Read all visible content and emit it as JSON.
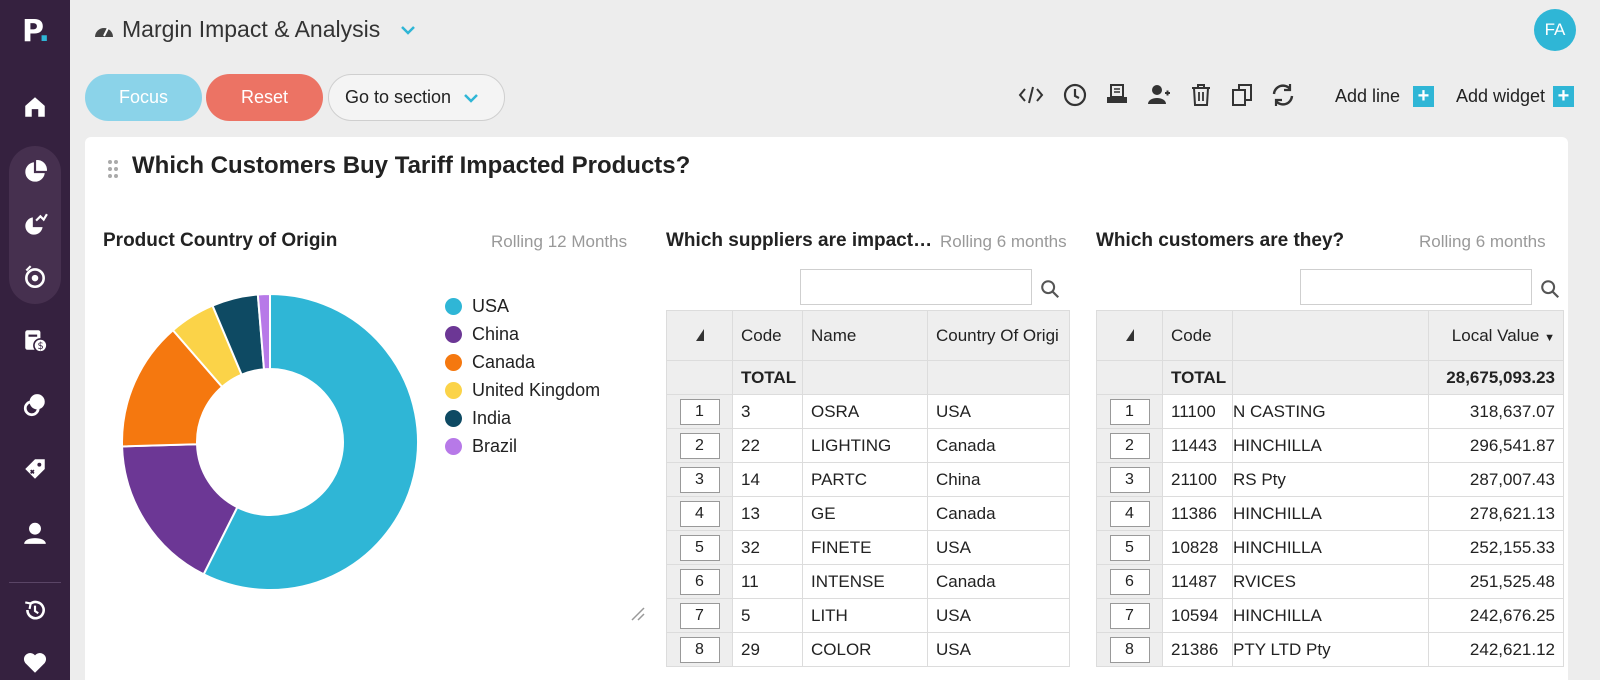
{
  "app": {
    "logo_letter": "P",
    "logo_dot": ".",
    "page_title": "Margin Impact & Analysis",
    "avatar_initials": "FA"
  },
  "toolbar": {
    "focus_label": "Focus",
    "reset_label": "Reset",
    "goto_label": "Go to section",
    "add_line_label": "Add line",
    "add_widget_label": "Add widget"
  },
  "section": {
    "title": "Which Customers Buy Tariff Impacted Products?"
  },
  "widgets": {
    "origin": {
      "title": "Product Country of Origin",
      "period": "Rolling 12 Months"
    },
    "suppliers": {
      "title": "Which suppliers are impact…",
      "period": "Rolling 6 months"
    },
    "customers": {
      "title": "Which customers are they?",
      "period": "Rolling 6 months"
    }
  },
  "chart_data": {
    "type": "pie",
    "categories": [
      "USA",
      "China",
      "Canada",
      "United Kingdom",
      "India",
      "Brazil"
    ],
    "values": [
      57,
      17,
      14,
      5,
      5,
      1.3
    ],
    "colors": [
      "#2fb6d6",
      "#6c3795",
      "#f5780f",
      "#fbd348",
      "#0e4a63",
      "#b779e8"
    ],
    "legend": "right"
  },
  "suppliers_table": {
    "headers": [
      "Code",
      "Name",
      "Country Of Origi"
    ],
    "total_label": "TOTAL",
    "rows": [
      {
        "n": "1",
        "code": "3",
        "name": "OSRA",
        "country": "USA"
      },
      {
        "n": "2",
        "code": "22",
        "name": "LIGHTING",
        "country": "Canada"
      },
      {
        "n": "3",
        "code": "14",
        "name": "PARTC",
        "country": "China"
      },
      {
        "n": "4",
        "code": "13",
        "name": "GE",
        "country": "Canada"
      },
      {
        "n": "5",
        "code": "32",
        "name": "FINETE",
        "country": "USA"
      },
      {
        "n": "6",
        "code": "11",
        "name": "INTENSE",
        "country": "Canada"
      },
      {
        "n": "7",
        "code": "5",
        "name": "LITH",
        "country": "USA"
      },
      {
        "n": "8",
        "code": "29",
        "name": "COLOR",
        "country": "USA"
      }
    ]
  },
  "customers_table": {
    "headers": [
      "Code",
      "",
      "Local Value"
    ],
    "total_label": "TOTAL",
    "total_value": "28,675,093.23",
    "rows": [
      {
        "n": "1",
        "code": "11100",
        "name": "N CASTING",
        "value": "318,637.07"
      },
      {
        "n": "2",
        "code": "11443",
        "name": "HINCHILLA",
        "value": "296,541.87"
      },
      {
        "n": "3",
        "code": "21100",
        "name": "RS Pty",
        "value": "287,007.43"
      },
      {
        "n": "4",
        "code": "11386",
        "name": "HINCHILLA",
        "value": "278,621.13"
      },
      {
        "n": "5",
        "code": "10828",
        "name": "HINCHILLA",
        "value": "252,155.33"
      },
      {
        "n": "6",
        "code": "11487",
        "name": "RVICES",
        "value": "251,525.48"
      },
      {
        "n": "7",
        "code": "10594",
        "name": "HINCHILLA",
        "value": "242,676.25"
      },
      {
        "n": "8",
        "code": "21386",
        "name": "PTY LTD Pty",
        "value": "242,621.12"
      }
    ]
  }
}
